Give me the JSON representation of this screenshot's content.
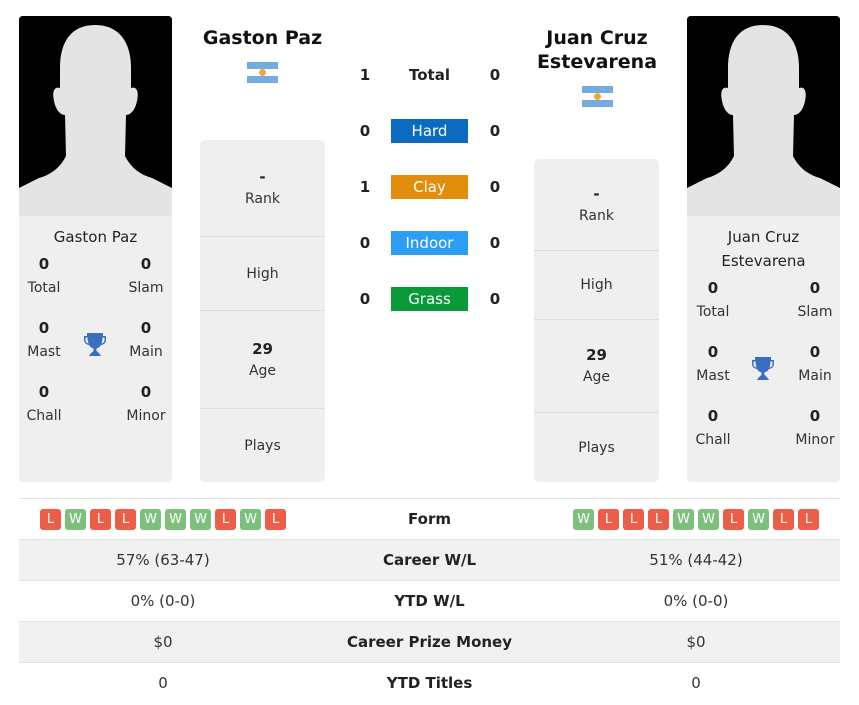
{
  "player1": {
    "name": "Gaston Paz",
    "country_flag": "argentina-flag",
    "titles": {
      "total": {
        "value": "0",
        "label": "Total"
      },
      "slam": {
        "value": "0",
        "label": "Slam"
      },
      "mast": {
        "value": "0",
        "label": "Mast"
      },
      "main": {
        "value": "0",
        "label": "Main"
      },
      "chall": {
        "value": "0",
        "label": "Chall"
      },
      "minor": {
        "value": "0",
        "label": "Minor"
      }
    },
    "info": {
      "rank": {
        "value": "-",
        "label": "Rank"
      },
      "high": {
        "value": "",
        "label": "High"
      },
      "age": {
        "value": "29",
        "label": "Age"
      },
      "plays": {
        "value": "",
        "label": "Plays"
      }
    },
    "form": [
      "L",
      "W",
      "L",
      "L",
      "W",
      "W",
      "W",
      "L",
      "W",
      "L"
    ],
    "career_wl": "57% (63-47)",
    "ytd_wl": "0% (0-0)",
    "prize_money": "$0",
    "ytd_titles": "0"
  },
  "player2": {
    "name": "Juan Cruz Estevarena",
    "country_flag": "argentina-flag",
    "titles": {
      "total": {
        "value": "0",
        "label": "Total"
      },
      "slam": {
        "value": "0",
        "label": "Slam"
      },
      "mast": {
        "value": "0",
        "label": "Mast"
      },
      "main": {
        "value": "0",
        "label": "Main"
      },
      "chall": {
        "value": "0",
        "label": "Chall"
      },
      "minor": {
        "value": "0",
        "label": "Minor"
      }
    },
    "info": {
      "rank": {
        "value": "-",
        "label": "Rank"
      },
      "high": {
        "value": "",
        "label": "High"
      },
      "age": {
        "value": "29",
        "label": "Age"
      },
      "plays": {
        "value": "",
        "label": "Plays"
      }
    },
    "form": [
      "W",
      "L",
      "L",
      "L",
      "W",
      "W",
      "L",
      "W",
      "L",
      "L"
    ],
    "career_wl": "51% (44-42)",
    "ytd_wl": "0% (0-0)",
    "prize_money": "$0",
    "ytd_titles": "0"
  },
  "h2h": {
    "total": {
      "label": "Total",
      "p1": "1",
      "p2": "0"
    },
    "surfaces": [
      {
        "label": "Hard",
        "p1": "0",
        "p2": "0",
        "color": "#0a6bc1"
      },
      {
        "label": "Clay",
        "p1": "1",
        "p2": "0",
        "color": "#e08e0b"
      },
      {
        "label": "Indoor",
        "p1": "0",
        "p2": "0",
        "color": "#2b9df4"
      },
      {
        "label": "Grass",
        "p1": "0",
        "p2": "0",
        "color": "#0a9a3a"
      }
    ]
  },
  "stats_labels": {
    "form": "Form",
    "career_wl": "Career W/L",
    "ytd_wl": "YTD W/L",
    "prize_money": "Career Prize Money",
    "ytd_titles": "YTD Titles"
  },
  "colors": {
    "win": "#7cc07c",
    "loss": "#ec5e47",
    "trophy": "#3a6fc0"
  }
}
